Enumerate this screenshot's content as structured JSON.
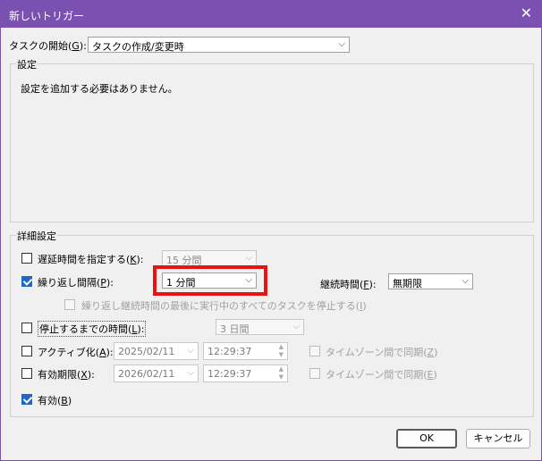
{
  "dialog": {
    "title": "新しいトリガー",
    "close_glyph": "✕"
  },
  "task_start": {
    "label_prefix": "タスクの開始(",
    "label_key": "G",
    "label_suffix": "):",
    "value": "タスクの作成/変更時"
  },
  "settings": {
    "title": "設定",
    "message": "設定を追加する必要はありません。"
  },
  "advanced": {
    "title": "詳細設定",
    "delay": {
      "checked": false,
      "label_prefix": "遅延時間を指定する(",
      "label_key": "K",
      "label_suffix": "):",
      "value": "15 分間"
    },
    "repeat": {
      "checked": true,
      "label_prefix": "繰り返し間隔(",
      "label_key": "P",
      "label_suffix": "):",
      "value": "1 分間",
      "duration_label_prefix": "継続時間(",
      "duration_key": "F",
      "duration_label_suffix": "):",
      "duration_value": "無期限",
      "stop_all_label_prefix": "繰り返し継続時間の最後に実行中のすべてのタスクを停止する(",
      "stop_all_key": "I",
      "stop_all_label_suffix": ")"
    },
    "stop_if_longer": {
      "checked": false,
      "label_prefix": "停止するまでの時間(",
      "label_key": "L",
      "label_suffix": "):",
      "value": "3 日間"
    },
    "activate": {
      "checked": false,
      "label_prefix": "アクティブ化(",
      "label_key": "A",
      "label_suffix": "):",
      "date": "2025/02/11",
      "time": "12:29:37",
      "sync_label_prefix": "タイムゾーン間で同期(",
      "sync_key": "Z",
      "sync_label_suffix": ")"
    },
    "expire": {
      "checked": false,
      "label_prefix": "有効期限(",
      "label_key": "X",
      "label_suffix": "):",
      "date": "2026/02/11",
      "time": "12:29:37",
      "sync_label_prefix": "タイムゾーン間で同期(",
      "sync_key": "E",
      "sync_label_suffix": ")"
    },
    "enabled": {
      "checked": true,
      "label_prefix": "有効(",
      "label_key": "B",
      "label_suffix": ")"
    }
  },
  "buttons": {
    "ok": "OK",
    "cancel": "キャンセル"
  },
  "colors": {
    "titlebar": "#7a51b0",
    "highlight": "#e81414",
    "checkbox_checked": "#1e66c8"
  }
}
